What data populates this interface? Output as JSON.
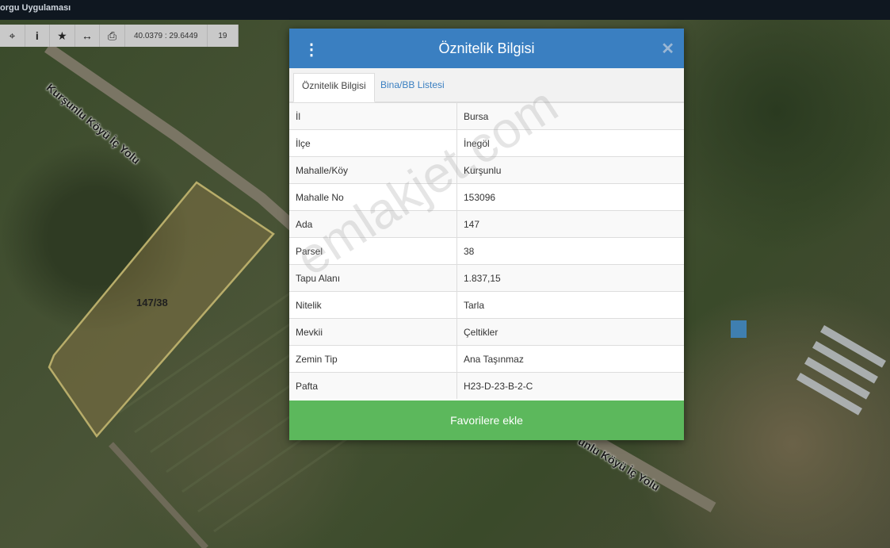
{
  "app": {
    "title": "orgu Uygulaması"
  },
  "toolbar": {
    "coordinates": "40.0379 : 29.6449",
    "zoom": "19"
  },
  "map": {
    "road_label_top": "Kurşunlu Köyü İç Yolu",
    "road_label_bottom": "unlu Köyü İç Yolu",
    "parcel_label": "147/38"
  },
  "modal": {
    "title": "Öznitelik Bilgisi",
    "tabs": [
      {
        "label": "Öznitelik Bilgisi",
        "active": true
      },
      {
        "label": "Bina/BB Listesi",
        "active": false
      }
    ],
    "rows": [
      {
        "key": "İl",
        "value": "Bursa"
      },
      {
        "key": "İlçe",
        "value": "İnegöl"
      },
      {
        "key": "Mahalle/Köy",
        "value": "Kurşunlu"
      },
      {
        "key": "Mahalle No",
        "value": "153096"
      },
      {
        "key": "Ada",
        "value": "147"
      },
      {
        "key": "Parsel",
        "value": "38"
      },
      {
        "key": "Tapu Alanı",
        "value": "1.837,15"
      },
      {
        "key": "Nitelik",
        "value": "Tarla"
      },
      {
        "key": "Mevkii",
        "value": "Çeltikler"
      },
      {
        "key": "Zemin Tip",
        "value": "Ana Taşınmaz"
      },
      {
        "key": "Pafta",
        "value": "H23-D-23-B-2-C"
      }
    ],
    "favorite_button": "Favorilere ekle"
  },
  "watermark": "emlakjet.com",
  "colors": {
    "header": "#3a7fc1",
    "favorite": "#5cb85c",
    "parcel_outline": "#b8ad6a"
  }
}
